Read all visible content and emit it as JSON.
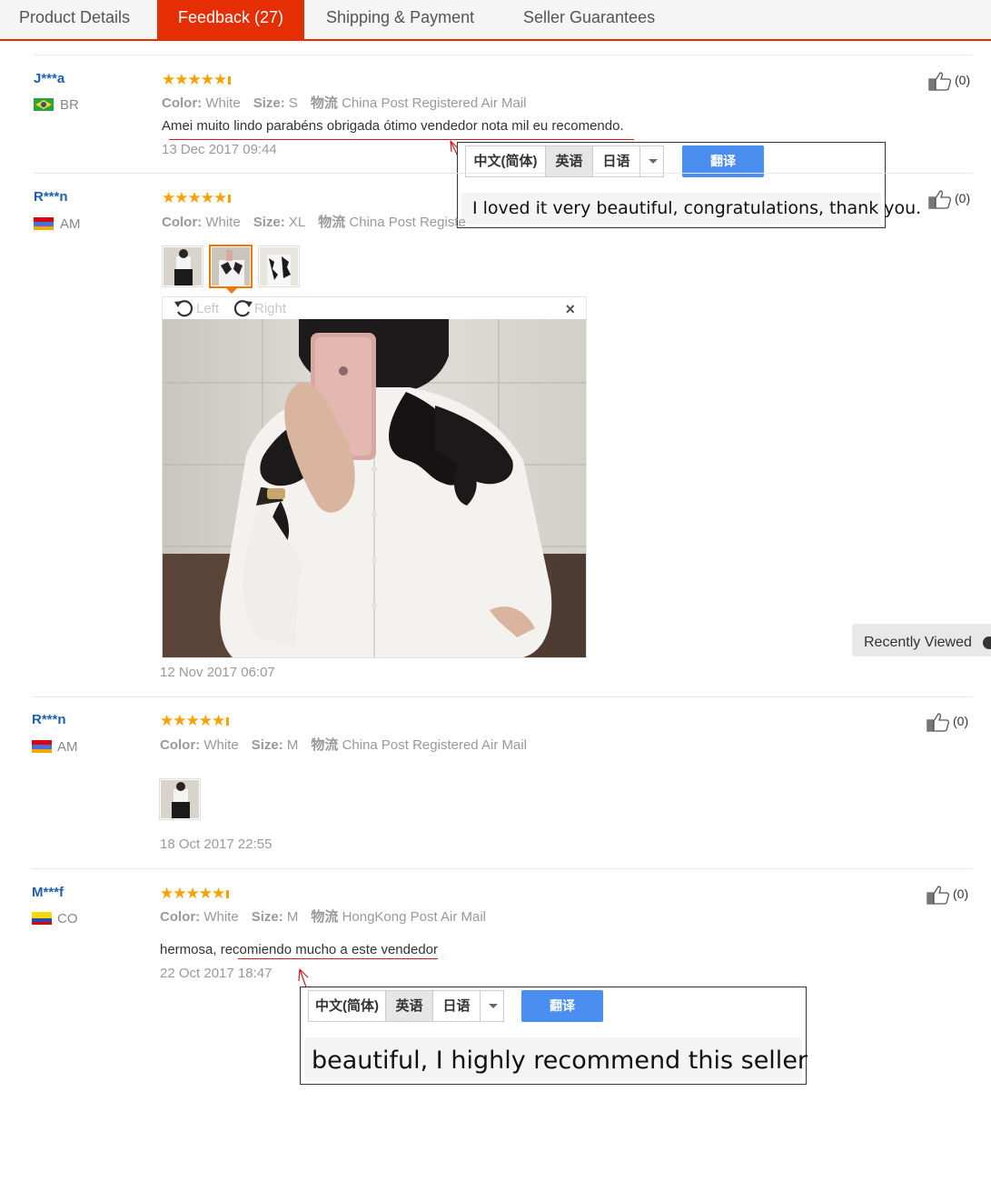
{
  "tabs": [
    {
      "label": "Product Details"
    },
    {
      "label": "Feedback (27)"
    },
    {
      "label": "Shipping & Payment"
    },
    {
      "label": "Seller Guarantees"
    }
  ],
  "active_tab": "Feedback (27)",
  "colors": {
    "accent": "#e62e04",
    "link": "#1e5fb0",
    "star": "#f7a200",
    "translate_button": "#4a8ef0"
  },
  "labels": {
    "color": "Color:",
    "size": "Size:",
    "logistics": "物流"
  },
  "reviews": [
    {
      "user": "J***a",
      "country": "BR",
      "rating": 5,
      "color": "White",
      "size": "S",
      "shipping": "China Post Registered Air Mail",
      "comment": "Amei muito lindo parabéns obrigada ótimo vendedor nota mil eu recomendo.",
      "date": "13 Dec 2017 09:44",
      "helpful": "(0)"
    },
    {
      "user": "R***n",
      "country": "AM",
      "rating": 5,
      "color": "White",
      "size": "XL",
      "shipping": "China Post Registe",
      "date": "12 Nov 2017 06:07",
      "helpful": "(0)"
    },
    {
      "user": "R***n",
      "country": "AM",
      "rating": 5,
      "color": "White",
      "size": "M",
      "shipping": "China Post Registered Air Mail",
      "date": "18 Oct 2017 22:55",
      "helpful": "(0)"
    },
    {
      "user": "M***f",
      "country": "CO",
      "rating": 5,
      "color": "White",
      "size": "M",
      "shipping": "HongKong Post Air Mail",
      "comment": "hermosa, recomiendo mucho a este vendedor",
      "date": "22 Oct 2017 18:47",
      "helpful": "(0)"
    }
  ],
  "translate": {
    "languages": [
      "中文(简体)",
      "英语",
      "日语"
    ],
    "selected_language": "英语",
    "button": "翻译",
    "results": [
      "I loved it very beautiful, congratulations, thank you.",
      "beautiful, I highly recommend this seller"
    ]
  },
  "image_viewer": {
    "rotate_left": "Left",
    "rotate_right": "Right",
    "close": "×"
  },
  "recently_viewed": "Recently Viewed"
}
